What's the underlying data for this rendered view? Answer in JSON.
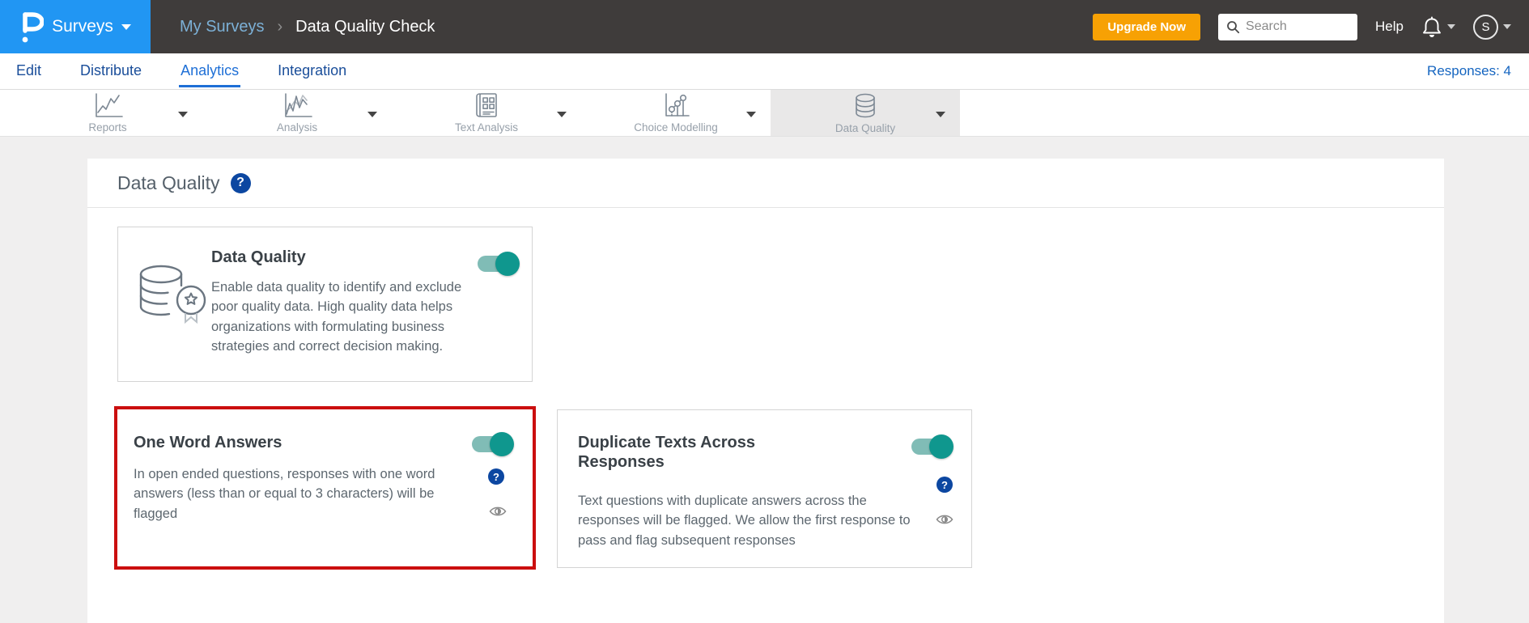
{
  "header": {
    "brand_label": "Surveys",
    "breadcrumb": {
      "parent": "My Surveys",
      "separator": "›",
      "current": "Data Quality Check"
    },
    "upgrade_label": "Upgrade Now",
    "search_placeholder": "Search",
    "help_label": "Help",
    "avatar_initial": "S"
  },
  "nav": {
    "tabs": [
      {
        "label": "Edit",
        "active": false
      },
      {
        "label": "Distribute",
        "active": false
      },
      {
        "label": "Analytics",
        "active": true
      },
      {
        "label": "Integration",
        "active": false
      }
    ],
    "responses_label": "Responses: 4"
  },
  "toolbar": {
    "items": [
      {
        "label": "Reports",
        "icon": "line-chart-icon",
        "active": false
      },
      {
        "label": "Analysis",
        "icon": "multi-line-chart-icon",
        "active": false
      },
      {
        "label": "Text Analysis",
        "icon": "report-document-icon",
        "active": false
      },
      {
        "label": "Choice Modelling",
        "icon": "bubble-chart-icon",
        "active": false
      },
      {
        "label": "Data Quality",
        "icon": "database-icon",
        "active": true
      }
    ]
  },
  "main": {
    "title": "Data Quality",
    "cards": [
      {
        "title": "Data Quality",
        "toggle": "on",
        "icon": "database-badge-icon",
        "description": "Enable data quality to identify and exclude poor quality data. High quality data helps organizations with formulating business strategies and correct decision making."
      },
      {
        "title": "One Word Answers",
        "toggle": "on",
        "highlighted": true,
        "description": "In open ended questions, responses with one word answers (less than or equal to 3 characters) will be flagged"
      },
      {
        "title": "Duplicate Texts Across Responses",
        "toggle": "on",
        "description": "Text questions with duplicate answers across the responses will be flagged. We allow the first response to pass and flag subsequent responses"
      }
    ],
    "help_mark": "?"
  },
  "colors": {
    "brand_blue": "#2196f3",
    "header_bg": "#3f3c3b",
    "accent_orange": "#f7a104",
    "toggle_on_knob": "#0f978e",
    "toggle_on_track": "#80bcb6",
    "active_tab_blue": "#1e6fd6",
    "help_badge_blue": "#0c47a1",
    "highlight_red": "#cb0f0f"
  }
}
